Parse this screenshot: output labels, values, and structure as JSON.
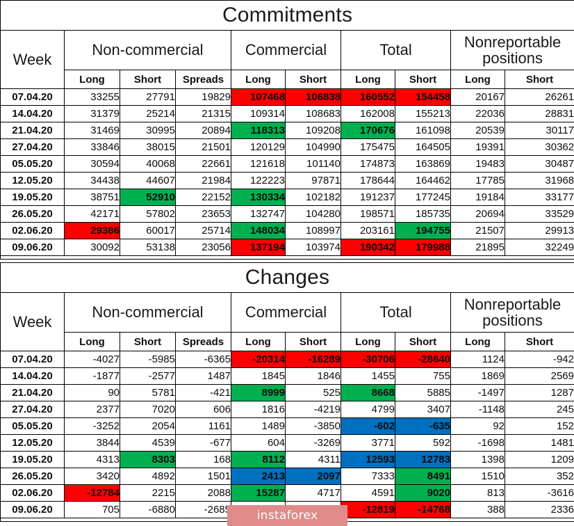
{
  "tables": [
    {
      "title": "Commitments",
      "columns": {
        "week": "Week",
        "groups": [
          {
            "label": "Non-commercial",
            "subs": [
              "Long",
              "Short",
              "Spreads"
            ]
          },
          {
            "label": "Commercial",
            "subs": [
              "Long",
              "Short"
            ]
          },
          {
            "label": "Total",
            "subs": [
              "Long",
              "Short"
            ]
          },
          {
            "label": "Nonreportable positions",
            "subs": [
              "Long",
              "Short"
            ]
          }
        ]
      },
      "rows": [
        {
          "week": "07.04.20",
          "cells": [
            {
              "v": "33255",
              "hl": ""
            },
            {
              "v": "27791",
              "hl": ""
            },
            {
              "v": "19829",
              "hl": ""
            },
            {
              "v": "107468",
              "hl": "red"
            },
            {
              "v": "106838",
              "hl": "red"
            },
            {
              "v": "160552",
              "hl": "red"
            },
            {
              "v": "154458",
              "hl": "red"
            },
            {
              "v": "20167",
              "hl": ""
            },
            {
              "v": "26261",
              "hl": ""
            }
          ]
        },
        {
          "week": "14.04.20",
          "cells": [
            {
              "v": "31379",
              "hl": ""
            },
            {
              "v": "25214",
              "hl": ""
            },
            {
              "v": "21315",
              "hl": ""
            },
            {
              "v": "109314",
              "hl": ""
            },
            {
              "v": "108683",
              "hl": ""
            },
            {
              "v": "162008",
              "hl": ""
            },
            {
              "v": "155213",
              "hl": ""
            },
            {
              "v": "22036",
              "hl": ""
            },
            {
              "v": "28831",
              "hl": ""
            }
          ]
        },
        {
          "week": "21.04.20",
          "cells": [
            {
              "v": "31469",
              "hl": ""
            },
            {
              "v": "30995",
              "hl": ""
            },
            {
              "v": "20894",
              "hl": ""
            },
            {
              "v": "118313",
              "hl": "green"
            },
            {
              "v": "109208",
              "hl": ""
            },
            {
              "v": "170676",
              "hl": "green"
            },
            {
              "v": "161098",
              "hl": ""
            },
            {
              "v": "20539",
              "hl": ""
            },
            {
              "v": "30117",
              "hl": ""
            }
          ]
        },
        {
          "week": "27.04.20",
          "cells": [
            {
              "v": "33846",
              "hl": ""
            },
            {
              "v": "38015",
              "hl": ""
            },
            {
              "v": "21501",
              "hl": ""
            },
            {
              "v": "120129",
              "hl": ""
            },
            {
              "v": "104990",
              "hl": ""
            },
            {
              "v": "175475",
              "hl": ""
            },
            {
              "v": "164505",
              "hl": ""
            },
            {
              "v": "19391",
              "hl": ""
            },
            {
              "v": "30362",
              "hl": ""
            }
          ]
        },
        {
          "week": "05.05.20",
          "cells": [
            {
              "v": "30594",
              "hl": ""
            },
            {
              "v": "40068",
              "hl": ""
            },
            {
              "v": "22661",
              "hl": ""
            },
            {
              "v": "121618",
              "hl": ""
            },
            {
              "v": "101140",
              "hl": ""
            },
            {
              "v": "174873",
              "hl": ""
            },
            {
              "v": "163869",
              "hl": ""
            },
            {
              "v": "19483",
              "hl": ""
            },
            {
              "v": "30487",
              "hl": ""
            }
          ]
        },
        {
          "week": "12.05.20",
          "cells": [
            {
              "v": "34438",
              "hl": ""
            },
            {
              "v": "44607",
              "hl": ""
            },
            {
              "v": "21984",
              "hl": ""
            },
            {
              "v": "122223",
              "hl": ""
            },
            {
              "v": "97871",
              "hl": ""
            },
            {
              "v": "178644",
              "hl": ""
            },
            {
              "v": "164462",
              "hl": ""
            },
            {
              "v": "17785",
              "hl": ""
            },
            {
              "v": "31968",
              "hl": ""
            }
          ]
        },
        {
          "week": "19.05.20",
          "cells": [
            {
              "v": "38751",
              "hl": ""
            },
            {
              "v": "52910",
              "hl": "green"
            },
            {
              "v": "22152",
              "hl": ""
            },
            {
              "v": "130334",
              "hl": "green"
            },
            {
              "v": "102182",
              "hl": ""
            },
            {
              "v": "191237",
              "hl": ""
            },
            {
              "v": "177245",
              "hl": ""
            },
            {
              "v": "19184",
              "hl": ""
            },
            {
              "v": "33177",
              "hl": ""
            }
          ]
        },
        {
          "week": "26.05.20",
          "cells": [
            {
              "v": "42171",
              "hl": ""
            },
            {
              "v": "57802",
              "hl": ""
            },
            {
              "v": "23653",
              "hl": ""
            },
            {
              "v": "132747",
              "hl": ""
            },
            {
              "v": "104280",
              "hl": ""
            },
            {
              "v": "198571",
              "hl": ""
            },
            {
              "v": "185735",
              "hl": ""
            },
            {
              "v": "20694",
              "hl": ""
            },
            {
              "v": "33529",
              "hl": ""
            }
          ]
        },
        {
          "week": "02.06.20",
          "cells": [
            {
              "v": "29386",
              "hl": "red"
            },
            {
              "v": "60017",
              "hl": ""
            },
            {
              "v": "25714",
              "hl": ""
            },
            {
              "v": "148034",
              "hl": "green"
            },
            {
              "v": "108997",
              "hl": ""
            },
            {
              "v": "203161",
              "hl": ""
            },
            {
              "v": "194755",
              "hl": "green"
            },
            {
              "v": "21507",
              "hl": ""
            },
            {
              "v": "29913",
              "hl": ""
            }
          ]
        },
        {
          "week": "09.06.20",
          "cells": [
            {
              "v": "30092",
              "hl": ""
            },
            {
              "v": "53138",
              "hl": ""
            },
            {
              "v": "23056",
              "hl": ""
            },
            {
              "v": "137194",
              "hl": "red"
            },
            {
              "v": "103974",
              "hl": ""
            },
            {
              "v": "190342",
              "hl": "red"
            },
            {
              "v": "179988",
              "hl": "red"
            },
            {
              "v": "21895",
              "hl": ""
            },
            {
              "v": "32249",
              "hl": ""
            }
          ]
        }
      ]
    },
    {
      "title": "Changes",
      "columns": {
        "week": "Week",
        "groups": [
          {
            "label": "Non-commercial",
            "subs": [
              "Long",
              "Short",
              "Spreads"
            ]
          },
          {
            "label": "Commercial",
            "subs": [
              "Long",
              "Short"
            ]
          },
          {
            "label": "Total",
            "subs": [
              "Long",
              "Short"
            ]
          },
          {
            "label": "Nonreportable positions",
            "subs": [
              "Long",
              "Short"
            ]
          }
        ]
      },
      "rows": [
        {
          "week": "07.04.20",
          "cells": [
            {
              "v": "-4027",
              "hl": ""
            },
            {
              "v": "-5985",
              "hl": ""
            },
            {
              "v": "-6365",
              "hl": ""
            },
            {
              "v": "-20314",
              "hl": "red"
            },
            {
              "v": "-16289",
              "hl": "red"
            },
            {
              "v": "-30706",
              "hl": "red"
            },
            {
              "v": "-28640",
              "hl": "red"
            },
            {
              "v": "1124",
              "hl": ""
            },
            {
              "v": "-942",
              "hl": ""
            }
          ]
        },
        {
          "week": "14.04.20",
          "cells": [
            {
              "v": "-1877",
              "hl": ""
            },
            {
              "v": "-2577",
              "hl": ""
            },
            {
              "v": "1487",
              "hl": ""
            },
            {
              "v": "1845",
              "hl": ""
            },
            {
              "v": "1846",
              "hl": ""
            },
            {
              "v": "1455",
              "hl": ""
            },
            {
              "v": "755",
              "hl": ""
            },
            {
              "v": "1869",
              "hl": ""
            },
            {
              "v": "2569",
              "hl": ""
            }
          ]
        },
        {
          "week": "21.04.20",
          "cells": [
            {
              "v": "90",
              "hl": ""
            },
            {
              "v": "5781",
              "hl": ""
            },
            {
              "v": "-421",
              "hl": ""
            },
            {
              "v": "8999",
              "hl": "green"
            },
            {
              "v": "525",
              "hl": ""
            },
            {
              "v": "8668",
              "hl": "green"
            },
            {
              "v": "5885",
              "hl": ""
            },
            {
              "v": "-1497",
              "hl": ""
            },
            {
              "v": "1287",
              "hl": ""
            }
          ]
        },
        {
          "week": "27.04.20",
          "cells": [
            {
              "v": "2377",
              "hl": ""
            },
            {
              "v": "7020",
              "hl": ""
            },
            {
              "v": "606",
              "hl": ""
            },
            {
              "v": "1816",
              "hl": ""
            },
            {
              "v": "-4219",
              "hl": ""
            },
            {
              "v": "4799",
              "hl": ""
            },
            {
              "v": "3407",
              "hl": ""
            },
            {
              "v": "-1148",
              "hl": ""
            },
            {
              "v": "245",
              "hl": ""
            }
          ]
        },
        {
          "week": "05.05.20",
          "cells": [
            {
              "v": "-3252",
              "hl": ""
            },
            {
              "v": "2054",
              "hl": ""
            },
            {
              "v": "1161",
              "hl": ""
            },
            {
              "v": "1489",
              "hl": ""
            },
            {
              "v": "-3850",
              "hl": ""
            },
            {
              "v": "-602",
              "hl": "blue"
            },
            {
              "v": "-635",
              "hl": "blue"
            },
            {
              "v": "92",
              "hl": ""
            },
            {
              "v": "152",
              "hl": ""
            }
          ]
        },
        {
          "week": "12.05.20",
          "cells": [
            {
              "v": "3844",
              "hl": ""
            },
            {
              "v": "4539",
              "hl": ""
            },
            {
              "v": "-677",
              "hl": ""
            },
            {
              "v": "604",
              "hl": ""
            },
            {
              "v": "-3269",
              "hl": ""
            },
            {
              "v": "3771",
              "hl": ""
            },
            {
              "v": "592",
              "hl": ""
            },
            {
              "v": "-1698",
              "hl": ""
            },
            {
              "v": "1481",
              "hl": ""
            }
          ]
        },
        {
          "week": "19.05.20",
          "cells": [
            {
              "v": "4313",
              "hl": ""
            },
            {
              "v": "8303",
              "hl": "green"
            },
            {
              "v": "168",
              "hl": ""
            },
            {
              "v": "8112",
              "hl": "green"
            },
            {
              "v": "4311",
              "hl": ""
            },
            {
              "v": "12593",
              "hl": "blue"
            },
            {
              "v": "12783",
              "hl": "blue"
            },
            {
              "v": "1398",
              "hl": ""
            },
            {
              "v": "1209",
              "hl": ""
            }
          ]
        },
        {
          "week": "26.05.20",
          "cells": [
            {
              "v": "3420",
              "hl": ""
            },
            {
              "v": "4892",
              "hl": ""
            },
            {
              "v": "1501",
              "hl": ""
            },
            {
              "v": "2413",
              "hl": "blue"
            },
            {
              "v": "2097",
              "hl": "blue"
            },
            {
              "v": "7333",
              "hl": ""
            },
            {
              "v": "8491",
              "hl": "green"
            },
            {
              "v": "1510",
              "hl": ""
            },
            {
              "v": "352",
              "hl": ""
            }
          ]
        },
        {
          "week": "02.06.20",
          "cells": [
            {
              "v": "-12784",
              "hl": "red"
            },
            {
              "v": "2215",
              "hl": ""
            },
            {
              "v": "2088",
              "hl": ""
            },
            {
              "v": "15287",
              "hl": "green"
            },
            {
              "v": "4717",
              "hl": ""
            },
            {
              "v": "4591",
              "hl": ""
            },
            {
              "v": "9020",
              "hl": "green"
            },
            {
              "v": "813",
              "hl": ""
            },
            {
              "v": "-3616",
              "hl": ""
            }
          ]
        },
        {
          "week": "09.06.20",
          "cells": [
            {
              "v": "705",
              "hl": ""
            },
            {
              "v": "-6880",
              "hl": ""
            },
            {
              "v": "-2685",
              "hl": ""
            },
            {
              "v": "",
              "hl": ""
            },
            {
              "v": "",
              "hl": ""
            },
            {
              "v": "-12819",
              "hl": "red"
            },
            {
              "v": "-14768",
              "hl": "red"
            },
            {
              "v": "388",
              "hl": ""
            },
            {
              "v": "2336",
              "hl": ""
            }
          ]
        }
      ]
    }
  ],
  "watermark": {
    "text": "instaforex"
  },
  "colors": {
    "red": "#ff0000",
    "green": "#00b050",
    "blue": "#0070c0",
    "border": "#000000",
    "background": "#ffffff"
  }
}
